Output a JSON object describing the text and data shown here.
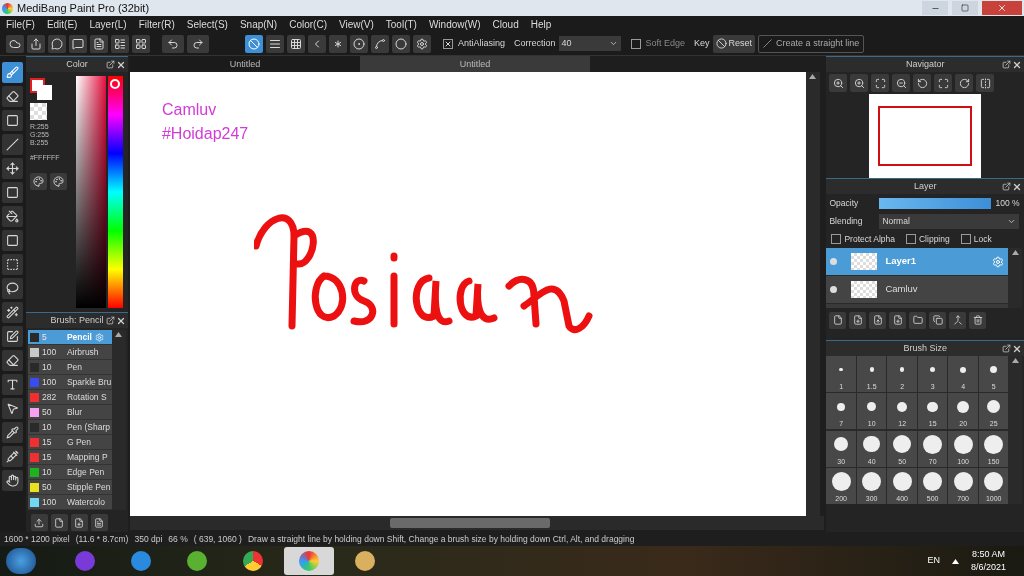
{
  "window": {
    "title": "MediBang Paint Pro (32bit)"
  },
  "menu": [
    "File(F)",
    "Edit(E)",
    "Layer(L)",
    "Filter(R)",
    "Select(S)",
    "Snap(N)",
    "Color(C)",
    "View(V)",
    "Tool(T)",
    "Window(W)",
    "Cloud",
    "Help"
  ],
  "snap_modes": [
    {
      "kind": "off",
      "selected": true
    },
    {
      "kind": "parallel",
      "selected": false
    },
    {
      "kind": "grid",
      "selected": false
    },
    {
      "kind": "vanish",
      "selected": false
    },
    {
      "kind": "radial",
      "selected": false
    },
    {
      "kind": "circle",
      "selected": false
    },
    {
      "kind": "curve",
      "selected": false
    },
    {
      "kind": "ellipse",
      "selected": false
    },
    {
      "kind": "settings",
      "selected": false
    }
  ],
  "toolbar": {
    "antialiasing": {
      "label": "AntiAliasing",
      "checked": true
    },
    "correction": {
      "label": "Correction",
      "value": "40"
    },
    "soft_edge": {
      "label": "Soft Edge",
      "checked": false
    },
    "key_label": "Key",
    "reset": "Reset",
    "straight_line": "Create a straight line"
  },
  "tabs": [
    {
      "label": "Untitled",
      "selected": true
    },
    {
      "label": "Untitled",
      "selected": false
    }
  ],
  "tools": [
    {
      "kind": "brush",
      "selected": true
    },
    {
      "kind": "eraser",
      "selected": false
    },
    {
      "kind": "rectangle",
      "selected": false
    },
    {
      "kind": "line",
      "selected": false
    },
    {
      "kind": "move",
      "selected": false
    },
    {
      "kind": "fill-rect",
      "selected": false
    },
    {
      "kind": "bucket",
      "selected": false
    },
    {
      "kind": "gradient",
      "selected": false
    },
    {
      "kind": "select",
      "selected": false
    },
    {
      "kind": "lasso",
      "selected": false
    },
    {
      "kind": "wand",
      "selected": false
    },
    {
      "kind": "select-pen",
      "selected": false
    },
    {
      "kind": "select-eraser",
      "selected": false
    },
    {
      "kind": "text",
      "selected": false
    },
    {
      "kind": "operation",
      "selected": false
    },
    {
      "kind": "dropper",
      "selected": false
    },
    {
      "kind": "pipette",
      "selected": false
    },
    {
      "kind": "hand",
      "selected": false
    }
  ],
  "color_panel": {
    "title": "Color",
    "hue": {
      "level": 0.0
    },
    "r": "R:255",
    "g": "G:255",
    "b": "B:255",
    "hex": "#FFFFFF"
  },
  "brush_panel": {
    "title": "Brush: Pencil",
    "brushes": [
      {
        "size": "5",
        "name": "Pencil",
        "color": "#2a2a2a",
        "selected": true
      },
      {
        "size": "100",
        "name": "Airbrush",
        "color": "#c8c8c8",
        "selected": false
      },
      {
        "size": "10",
        "name": "Pen",
        "color": "#2a2a2a",
        "selected": false
      },
      {
        "size": "100",
        "name": "Sparkle Bru",
        "color": "#3a4cf0",
        "selected": false
      },
      {
        "size": "282",
        "name": "Rotation S",
        "color": "#f03030",
        "selected": false
      },
      {
        "size": "50",
        "name": "Blur",
        "color": "#f5a0f0",
        "selected": false
      },
      {
        "size": "10",
        "name": "Pen (Sharp",
        "color": "#2a2a2a",
        "selected": false
      },
      {
        "size": "15",
        "name": "G Pen",
        "color": "#f03030",
        "selected": false
      },
      {
        "size": "15",
        "name": "Mapping P",
        "color": "#f03030",
        "selected": false
      },
      {
        "size": "10",
        "name": "Edge Pen",
        "color": "#20b020",
        "selected": false
      },
      {
        "size": "50",
        "name": "Stipple Pen",
        "color": "#e8e020",
        "selected": false
      },
      {
        "size": "100",
        "name": "Watercolo",
        "color": "#70d8f0",
        "selected": false
      }
    ]
  },
  "canvas": {
    "texts": [
      "Camluv",
      "#Hoidap247"
    ]
  },
  "navigator": {
    "title": "Navigator"
  },
  "layer_panel": {
    "title": "Layer",
    "opacity_label": "Opacity",
    "opacity": {
      "level": 1.0,
      "reading": "100 %"
    },
    "blending_label": "Blending",
    "blending": "Normal",
    "options": [
      {
        "label": "Protect Alpha",
        "checked": false
      },
      {
        "label": "Clipping",
        "checked": false
      },
      {
        "label": "Lock",
        "checked": false
      }
    ],
    "layers": [
      {
        "name": "Layer1",
        "selected": true
      },
      {
        "name": "Camluv",
        "selected": false
      }
    ]
  },
  "brush_size": {
    "title": "Brush Size",
    "sizes": [
      "1",
      "1.5",
      "2",
      "3",
      "4",
      "5",
      "7",
      "10",
      "12",
      "15",
      "20",
      "25",
      "30",
      "40",
      "50",
      "70",
      "100",
      "150",
      "200",
      "300",
      "400",
      "500",
      "700",
      "1000"
    ]
  },
  "status_bar": [
    "1600 * 1200 pixel",
    "(11.6 * 8.7cm)",
    "350 dpi",
    "66 %",
    "( 639, 1060 )",
    "Draw a straight line by holding down Shift, Change a brush size by holding down Ctrl, Alt, and dragging"
  ],
  "taskbar": {
    "apps": [
      {
        "kind": "vs",
        "selected": false
      },
      {
        "kind": "ie",
        "selected": false
      },
      {
        "kind": "coccoc",
        "selected": false
      },
      {
        "kind": "chrome",
        "selected": false
      },
      {
        "kind": "medibang",
        "selected": true
      },
      {
        "kind": "paint",
        "selected": false
      }
    ],
    "language": "EN",
    "time": "8:50 AM",
    "date": "8/6/2021"
  }
}
